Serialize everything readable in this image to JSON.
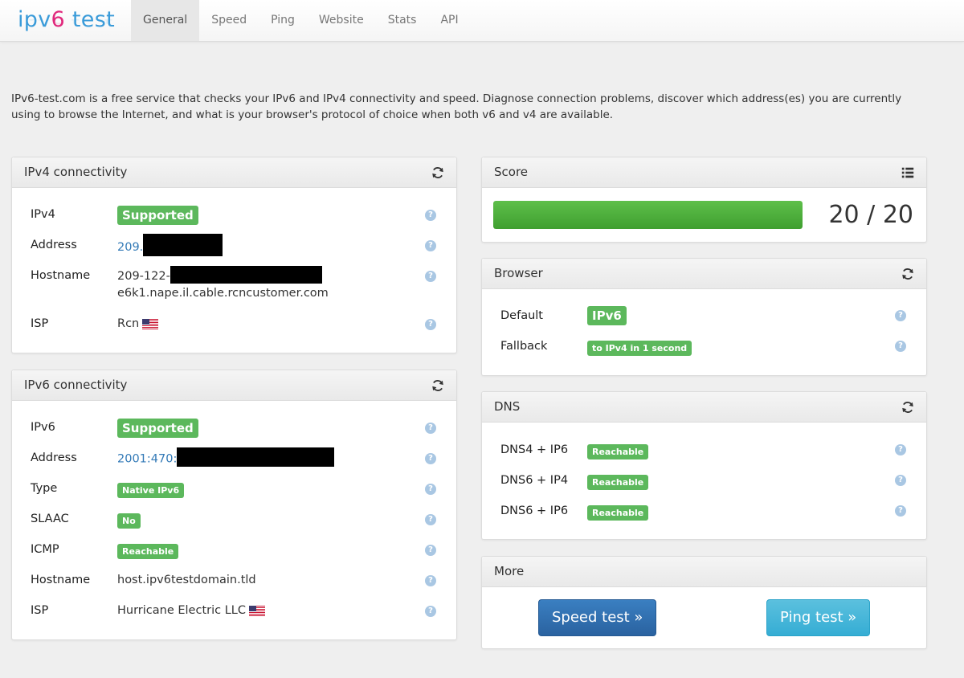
{
  "brand": {
    "part1": "ipv",
    "part2": "6",
    "part3": " test"
  },
  "nav": [
    "General",
    "Speed",
    "Ping",
    "Website",
    "Stats",
    "API"
  ],
  "intro": "IPv6-test.com is a free service that checks your IPv6 and IPv4 connectivity and speed. Diagnose connection problems, discover which address(es) you are currently using to browse the Internet, and what is your browser's protocol of choice when both v6 and v4 are available.",
  "ipv4": {
    "title": "IPv4 connectivity",
    "labels": {
      "ipv4": "IPv4",
      "address": "Address",
      "hostname": "Hostname",
      "isp": "ISP"
    },
    "status": "Supported",
    "address": "209.",
    "hostname_line1": "209-122-",
    "hostname_line2": "e6k1.nape.il.cable.rcncustomer.com",
    "isp": "Rcn"
  },
  "ipv6": {
    "title": "IPv6 connectivity",
    "labels": {
      "ipv6": "IPv6",
      "address": "Address",
      "type": "Type",
      "slaac": "SLAAC",
      "icmp": "ICMP",
      "hostname": "Hostname",
      "isp": "ISP"
    },
    "status": "Supported",
    "address": "2001:470:",
    "type": "Native IPv6",
    "slaac": "No",
    "icmp": "Reachable",
    "hostname": "host.ipv6testdomain.tld",
    "isp": "Hurricane Electric LLC"
  },
  "score": {
    "title": "Score",
    "text": "20 / 20",
    "fraction": 1.0
  },
  "browser": {
    "title": "Browser",
    "labels": {
      "default": "Default",
      "fallback": "Fallback"
    },
    "default": "IPv6",
    "fallback": "to IPv4 in 1 second"
  },
  "dns": {
    "title": "DNS",
    "rows": [
      {
        "label": "DNS4 + IP6",
        "value": "Reachable"
      },
      {
        "label": "DNS6 + IP4",
        "value": "Reachable"
      },
      {
        "label": "DNS6 + IP6",
        "value": "Reachable"
      }
    ]
  },
  "more": {
    "title": "More",
    "speed_button": "Speed test »",
    "ping_button": "Ping test »"
  },
  "help_glyph": "?",
  "icons": {
    "refresh": "refresh-icon",
    "list": "list-icon",
    "help": "help-icon",
    "flag": "us-flag-icon"
  },
  "colors": {
    "success": "#5cb85c",
    "primary": "#2a62a0",
    "info": "#5bc0de",
    "link": "#337ab7",
    "brand_blue": "#3a9bd9",
    "brand_pink": "#e0287c"
  }
}
